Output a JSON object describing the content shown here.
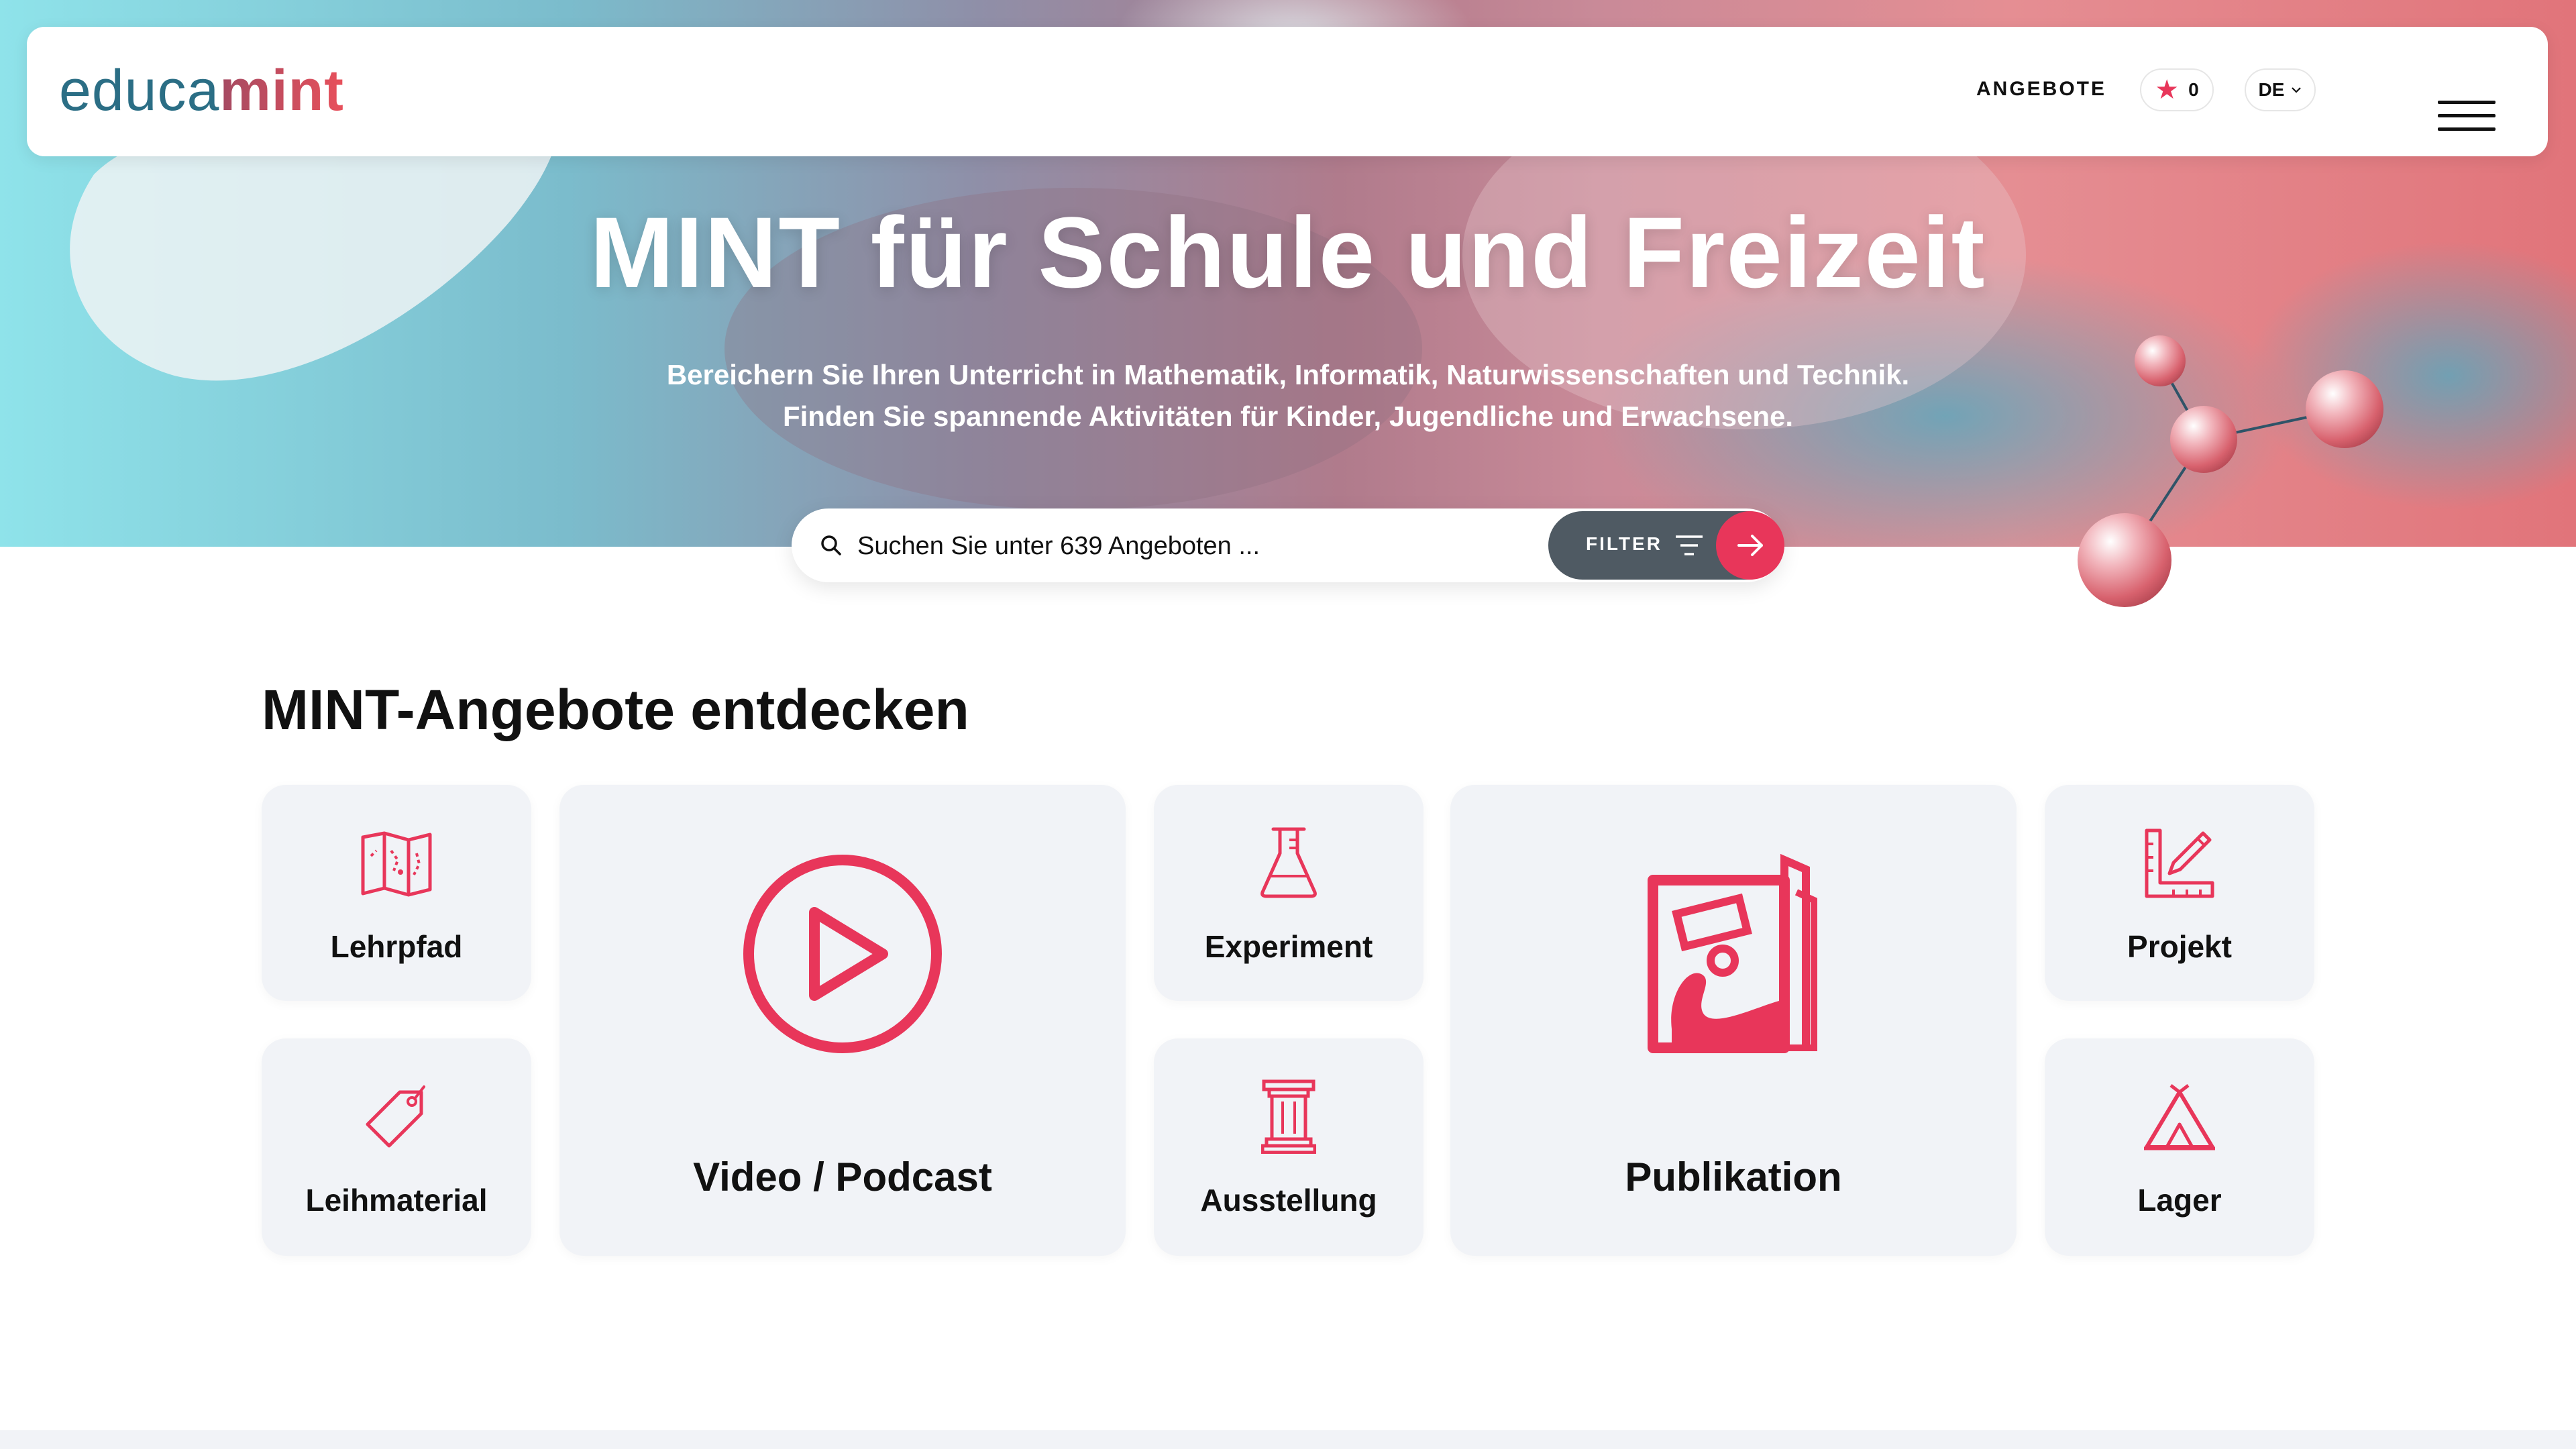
{
  "header": {
    "logo_part1": "educa",
    "logo_part2": "mint",
    "nav_offers": "ANGEBOTE",
    "favorites_icon": "star-icon",
    "favorites_count": "0",
    "language": "DE",
    "menu_icon": "hamburger-icon"
  },
  "hero": {
    "title": "MINT für Schule und Freizeit",
    "subtitle_line1": "Bereichern Sie Ihren Unterricht in Mathematik, Informatik, Naturwissenschaften und Technik.",
    "subtitle_line2": "Finden Sie spannende Aktivitäten für Kinder, Jugendliche und Erwachsene."
  },
  "search": {
    "placeholder": "Suchen Sie unter 639 Angeboten ...",
    "value": "",
    "filter_label": "FILTER",
    "icons": [
      "search-icon",
      "filter-icon",
      "arrow-right-icon"
    ]
  },
  "section": {
    "title": "MINT-Angebote entdecken"
  },
  "categories": [
    {
      "label": "Lehrpfad",
      "icon": "map-icon"
    },
    {
      "label": "Video / Podcast",
      "icon": "play-icon"
    },
    {
      "label": "Experiment",
      "icon": "flask-icon"
    },
    {
      "label": "Publikation",
      "icon": "publication-icon"
    },
    {
      "label": "Projekt",
      "icon": "ruler-pencil-icon"
    },
    {
      "label": "Leihmaterial",
      "icon": "tag-icon"
    },
    {
      "label": "Ausstellung",
      "icon": "column-icon"
    },
    {
      "label": "Lager",
      "icon": "tent-icon"
    }
  ],
  "colors": {
    "accent": "#e8365a",
    "logo_blue": "#2b6e85",
    "card_bg": "#f1f3f7",
    "filter_bg": "#4f5a63"
  }
}
